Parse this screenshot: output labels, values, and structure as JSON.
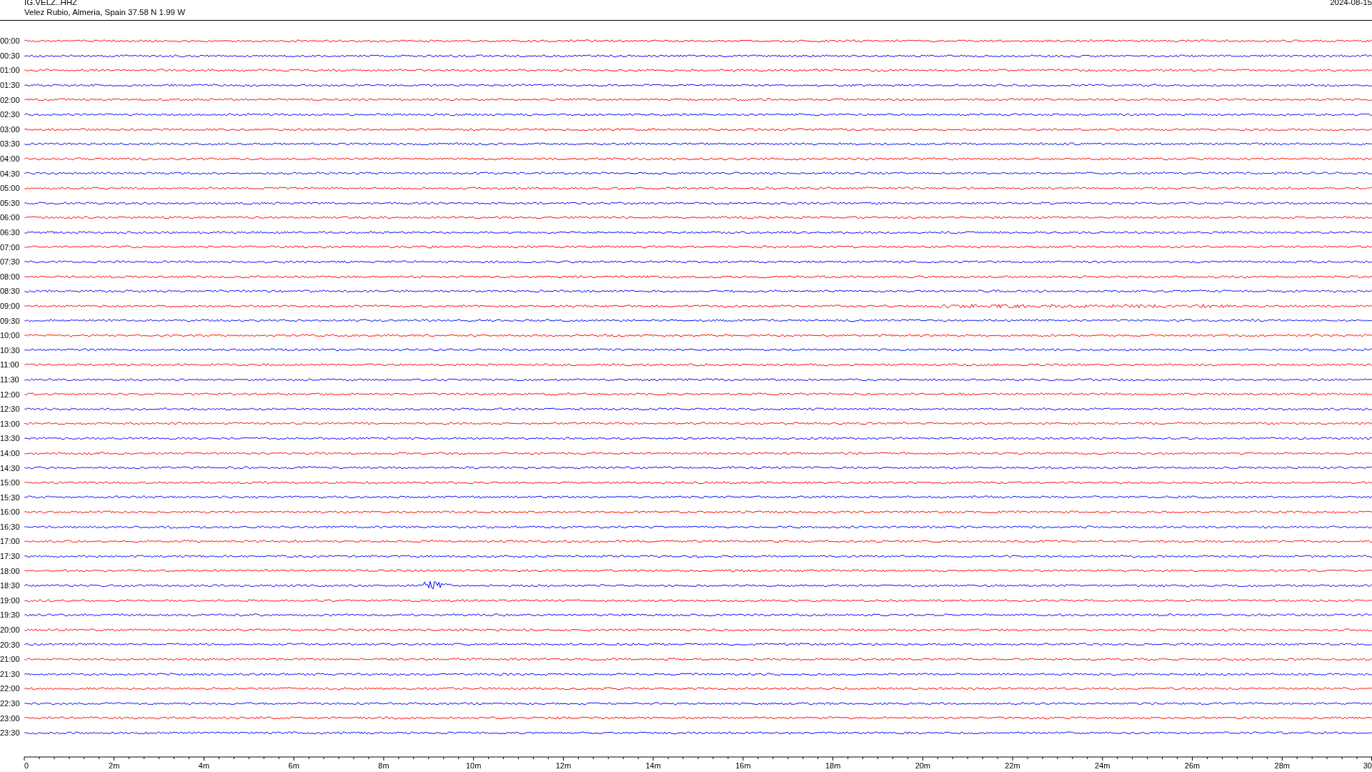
{
  "header": {
    "station": "IG.VELZ..HHZ",
    "location": "Velez Rubio, Almeria, Spain  37.58 N 1.99 W",
    "date": "2024-08-15"
  },
  "rows": [
    {
      "label": "00:00",
      "color": "#ff0000",
      "kind": "plain"
    },
    {
      "label": "00:30",
      "color": "#0000ff",
      "kind": "plain"
    },
    {
      "label": "01:00",
      "color": "#ff0000",
      "kind": "plain"
    },
    {
      "label": "01:30",
      "color": "#0000ff",
      "kind": "plain"
    },
    {
      "label": "02:00",
      "color": "#ff0000",
      "kind": "plain"
    },
    {
      "label": "02:30",
      "color": "#0000ff",
      "kind": "plain"
    },
    {
      "label": "03:00",
      "color": "#ff0000",
      "kind": "plain"
    },
    {
      "label": "03:30",
      "color": "#0000ff",
      "kind": "plain"
    },
    {
      "label": "04:00",
      "color": "#ff0000",
      "kind": "plain"
    },
    {
      "label": "04:30",
      "color": "#0000ff",
      "kind": "plain"
    },
    {
      "label": "05:00",
      "color": "#ff0000",
      "kind": "plain"
    },
    {
      "label": "05:30",
      "color": "#0000ff",
      "kind": "plain"
    },
    {
      "label": "06:00",
      "color": "#ff0000",
      "kind": "plain"
    },
    {
      "label": "06:30",
      "color": "#0000ff",
      "kind": "plain"
    },
    {
      "label": "07:00",
      "color": "#ff0000",
      "kind": "plain"
    },
    {
      "label": "07:30",
      "color": "#0000ff",
      "kind": "plain"
    },
    {
      "label": "08:00",
      "color": "#ff0000",
      "kind": "plain"
    },
    {
      "label": "08:30",
      "color": "#0000ff",
      "kind": "plain"
    },
    {
      "label": "09:00",
      "color": "#ff0000",
      "kind": "noisy"
    },
    {
      "label": "09:30",
      "color": "#0000ff",
      "kind": "plain"
    },
    {
      "label": "10:00",
      "color": "#ff0000",
      "kind": "plain"
    },
    {
      "label": "10:30",
      "color": "#0000ff",
      "kind": "plain"
    },
    {
      "label": "11:00",
      "color": "#ff0000",
      "kind": "plain"
    },
    {
      "label": "11:30",
      "color": "#0000ff",
      "kind": "plain"
    },
    {
      "label": "12:00",
      "color": "#ff0000",
      "kind": "plain"
    },
    {
      "label": "12:30",
      "color": "#0000ff",
      "kind": "plain"
    },
    {
      "label": "13:00",
      "color": "#ff0000",
      "kind": "plain"
    },
    {
      "label": "13:30",
      "color": "#0000ff",
      "kind": "plain"
    },
    {
      "label": "14:00",
      "color": "#ff0000",
      "kind": "plain"
    },
    {
      "label": "14:30",
      "color": "#0000ff",
      "kind": "plain"
    },
    {
      "label": "15:00",
      "color": "#ff0000",
      "kind": "plain"
    },
    {
      "label": "15:30",
      "color": "#0000ff",
      "kind": "plain"
    },
    {
      "label": "16:00",
      "color": "#ff0000",
      "kind": "plain"
    },
    {
      "label": "16:30",
      "color": "#0000ff",
      "kind": "plain"
    },
    {
      "label": "17:00",
      "color": "#ff0000",
      "kind": "plain"
    },
    {
      "label": "17:30",
      "color": "#0000ff",
      "kind": "plain"
    },
    {
      "label": "18:00",
      "color": "#ff0000",
      "kind": "plain"
    },
    {
      "label": "18:30",
      "color": "#0000ff",
      "kind": "quake"
    },
    {
      "label": "19:00",
      "color": "#ff0000",
      "kind": "plain"
    },
    {
      "label": "19:30",
      "color": "#0000ff",
      "kind": "plain"
    },
    {
      "label": "20:00",
      "color": "#ff0000",
      "kind": "plain"
    },
    {
      "label": "20:30",
      "color": "#0000ff",
      "kind": "plain"
    },
    {
      "label": "21:00",
      "color": "#ff0000",
      "kind": "plain"
    },
    {
      "label": "21:30",
      "color": "#0000ff",
      "kind": "plain"
    },
    {
      "label": "22:00",
      "color": "#ff0000",
      "kind": "plain"
    },
    {
      "label": "22:30",
      "color": "#0000ff",
      "kind": "plain"
    },
    {
      "label": "23:00",
      "color": "#ff0000",
      "kind": "plain"
    },
    {
      "label": "23:30",
      "color": "#0000ff",
      "kind": "plain"
    }
  ],
  "axis": {
    "labels": [
      "0",
      "2m",
      "4m",
      "6m",
      "8m",
      "10m",
      "12m",
      "14m",
      "16m",
      "18m",
      "20m",
      "22m",
      "24m",
      "26m",
      "28m",
      "30"
    ]
  }
}
